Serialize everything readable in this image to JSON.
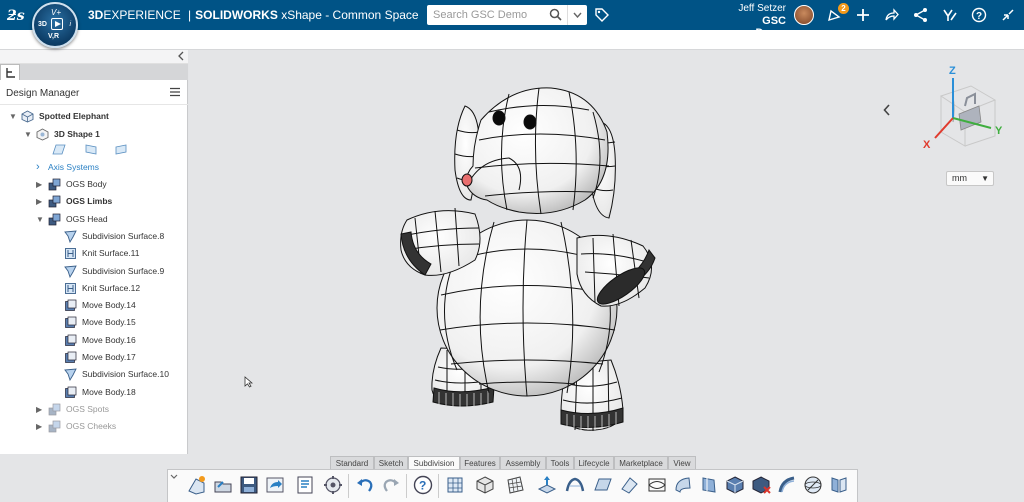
{
  "topbar": {
    "brand_prefix": "3D",
    "brand_name": "EXPERIENCE",
    "brand_separator": "|",
    "product": "SOLIDWORKS",
    "app_name": "xShape - Common Space",
    "compass": {
      "top": "V+",
      "left": "3D",
      "right": "i",
      "bottom": "V,R"
    },
    "search_placeholder": "Search GSC Demo",
    "user_name": "Jeff Setzer",
    "user_org": "GSC Demo",
    "notification_count": "2",
    "colors": {
      "bar": "#005386",
      "badge": "#f39a1b"
    }
  },
  "panel": {
    "title": "Design Manager",
    "tree": [
      {
        "label": "Spotted Elephant",
        "level": 0,
        "arrow": "▼",
        "bold": true,
        "icon": "product-icon"
      },
      {
        "label": "3D Shape 1",
        "level": 1,
        "arrow": "▼",
        "bold": true,
        "icon": "shape-icon"
      },
      {
        "label": "Axis Systems",
        "level": 2,
        "arrow": "›",
        "link": true
      },
      {
        "label": "OGS Body",
        "level": 2,
        "arrow": "▶",
        "icon": "geo-set-icon"
      },
      {
        "label": "OGS Limbs",
        "level": 2,
        "arrow": "▶",
        "bold": true,
        "icon": "geo-set-icon"
      },
      {
        "label": "OGS Head",
        "level": 2,
        "arrow": "▼",
        "icon": "geo-set-icon"
      },
      {
        "label": "Subdivision Surface.8",
        "level": 3,
        "icon": "subdivision-surface-icon"
      },
      {
        "label": "Knit Surface.11",
        "level": 3,
        "icon": "knit-surface-icon"
      },
      {
        "label": "Subdivision Surface.9",
        "level": 3,
        "icon": "subdivision-surface-icon"
      },
      {
        "label": "Knit Surface.12",
        "level": 3,
        "icon": "knit-surface-icon"
      },
      {
        "label": "Move Body.14",
        "level": 3,
        "icon": "move-body-icon"
      },
      {
        "label": "Move Body.15",
        "level": 3,
        "icon": "move-body-icon"
      },
      {
        "label": "Move Body.16",
        "level": 3,
        "icon": "move-body-icon"
      },
      {
        "label": "Move Body.17",
        "level": 3,
        "icon": "move-body-icon"
      },
      {
        "label": "Subdivision Surface.10",
        "level": 3,
        "icon": "subdivision-surface-icon"
      },
      {
        "label": "Move Body.18",
        "level": 3,
        "icon": "move-body-icon"
      },
      {
        "label": "OGS Spots",
        "level": 2,
        "arrow": "▶",
        "dim": true,
        "icon": "geo-set-icon"
      },
      {
        "label": "OGS Cheeks",
        "level": 2,
        "arrow": "▶",
        "dim": true,
        "icon": "geo-set-icon"
      }
    ],
    "planes": [
      "xy",
      "yz",
      "zx"
    ]
  },
  "viewport": {
    "unit": "mm",
    "axes": {
      "x": "X",
      "y": "Y",
      "z": "Z"
    }
  },
  "tabs": [
    {
      "label": "Standard",
      "active": false
    },
    {
      "label": "Sketch",
      "active": false
    },
    {
      "label": "Subdivision",
      "active": true
    },
    {
      "label": "Features",
      "active": false
    },
    {
      "label": "Assembly",
      "active": false
    },
    {
      "label": "Tools",
      "active": false
    },
    {
      "label": "Lifecycle",
      "active": false
    },
    {
      "label": "Marketplace",
      "active": false
    },
    {
      "label": "View",
      "active": false
    }
  ],
  "toolbar": {
    "icons": [
      "new-shape-icon",
      "open-icon",
      "save-icon",
      "share-icon",
      "properties-icon",
      "settings-icon",
      "undo-icon",
      "redo-icon",
      "help-icon",
      "subdivision-box-icon",
      "primitive-icon",
      "mesh-icon",
      "extrude-face-icon",
      "bridge-icon",
      "plane-surface-icon",
      "fill-icon",
      "edge-flow-icon",
      "sweep-icon",
      "revolve-icon",
      "cube-icon",
      "delete-face-icon",
      "curve-icon",
      "sphere-icon",
      "mirror-icon",
      "symmetry-icon"
    ]
  }
}
